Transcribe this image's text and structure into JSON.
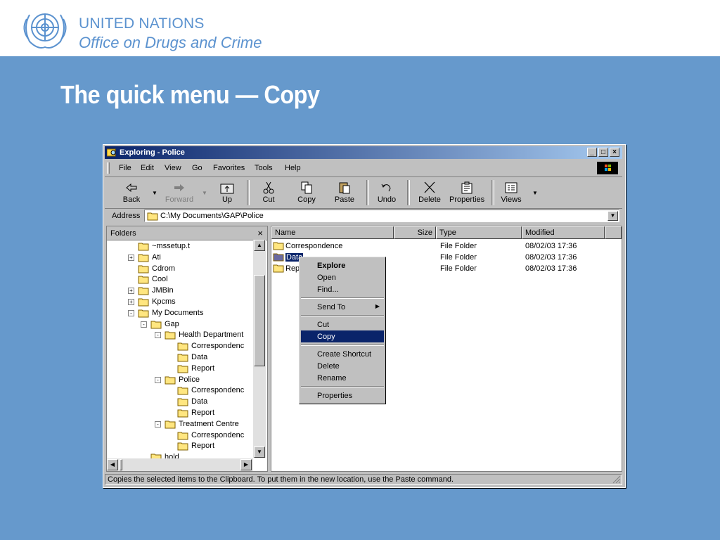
{
  "header": {
    "org_line1": "UNITED NATIONS",
    "org_line2": "Office on Drugs and Crime"
  },
  "slide": {
    "title": "The quick menu — Copy"
  },
  "colors": {
    "slide_background": "#6699cc",
    "title_bar": "#0a246a",
    "selection": "#0a246a",
    "logo_blue": "#5b92cf"
  },
  "window": {
    "title": "Exploring - Police",
    "controls": [
      "_",
      "□",
      "×"
    ],
    "menu": [
      "File",
      "Edit",
      "View",
      "Go",
      "Favorites",
      "Tools",
      "Help"
    ],
    "toolbar": [
      {
        "label": "Back",
        "icon": "back-arrow-icon"
      },
      {
        "label": "Forward",
        "icon": "forward-arrow-icon"
      },
      {
        "label": "Up",
        "icon": "up-folder-icon"
      },
      {
        "label": "Cut",
        "icon": "scissors-icon"
      },
      {
        "label": "Copy",
        "icon": "copy-icon"
      },
      {
        "label": "Paste",
        "icon": "paste-icon"
      },
      {
        "label": "Undo",
        "icon": "undo-icon"
      },
      {
        "label": "Delete",
        "icon": "delete-x-icon"
      },
      {
        "label": "Properties",
        "icon": "properties-icon"
      },
      {
        "label": "Views",
        "icon": "views-icon"
      }
    ],
    "address": {
      "label": "Address",
      "value": "C:\\My Documents\\GAP\\Police"
    },
    "folders_pane": {
      "title": "Folders",
      "close": "×",
      "tree": [
        {
          "label": "~mssetup.t",
          "level": 0,
          "toggle": ""
        },
        {
          "label": "Ati",
          "level": 0,
          "toggle": "+"
        },
        {
          "label": "Cdrom",
          "level": 0,
          "toggle": ""
        },
        {
          "label": "Cool",
          "level": 0,
          "toggle": ""
        },
        {
          "label": "JMBin",
          "level": 0,
          "toggle": "+"
        },
        {
          "label": "Kpcms",
          "level": 0,
          "toggle": "+"
        },
        {
          "label": "My Documents",
          "level": 0,
          "toggle": "-"
        },
        {
          "label": "Gap",
          "level": 1,
          "toggle": "-"
        },
        {
          "label": "Health Department",
          "level": 2,
          "toggle": "-"
        },
        {
          "label": "Correspondenc",
          "level": 3,
          "toggle": ""
        },
        {
          "label": "Data",
          "level": 3,
          "toggle": ""
        },
        {
          "label": "Report",
          "level": 3,
          "toggle": ""
        },
        {
          "label": "Police",
          "level": 2,
          "toggle": "-"
        },
        {
          "label": "Correspondenc",
          "level": 3,
          "toggle": ""
        },
        {
          "label": "Data",
          "level": 3,
          "toggle": ""
        },
        {
          "label": "Report",
          "level": 3,
          "toggle": ""
        },
        {
          "label": "Treatment Centre",
          "level": 2,
          "toggle": "-"
        },
        {
          "label": "Correspondenc",
          "level": 3,
          "toggle": ""
        },
        {
          "label": "Report",
          "level": 3,
          "toggle": ""
        },
        {
          "label": "hold",
          "level": 1,
          "toggle": ""
        }
      ]
    },
    "file_list": {
      "columns": [
        "Name",
        "Size",
        "Type",
        "Modified"
      ],
      "rows": [
        {
          "name": "Correspondence",
          "size": "",
          "type": "File Folder",
          "modified": "08/02/03 17:36",
          "selected": false
        },
        {
          "name": "Data",
          "size": "",
          "type": "File Folder",
          "modified": "08/02/03 17:36",
          "selected": true
        },
        {
          "name": "Repo",
          "size": "",
          "type": "File Folder",
          "modified": "08/02/03 17:36",
          "selected": false
        }
      ]
    },
    "context_menu": {
      "items": [
        {
          "label": "Explore",
          "bold": true
        },
        {
          "label": "Open"
        },
        {
          "label": "Find..."
        },
        {
          "sep": true
        },
        {
          "label": "Send To",
          "submenu": true
        },
        {
          "sep": true
        },
        {
          "label": "Cut"
        },
        {
          "label": "Copy",
          "selected": true
        },
        {
          "sep": true
        },
        {
          "label": "Create Shortcut"
        },
        {
          "label": "Delete"
        },
        {
          "label": "Rename"
        },
        {
          "sep": true
        },
        {
          "label": "Properties"
        }
      ]
    },
    "status": "Copies the selected items to the Clipboard. To put them in the new location, use the Paste command."
  }
}
